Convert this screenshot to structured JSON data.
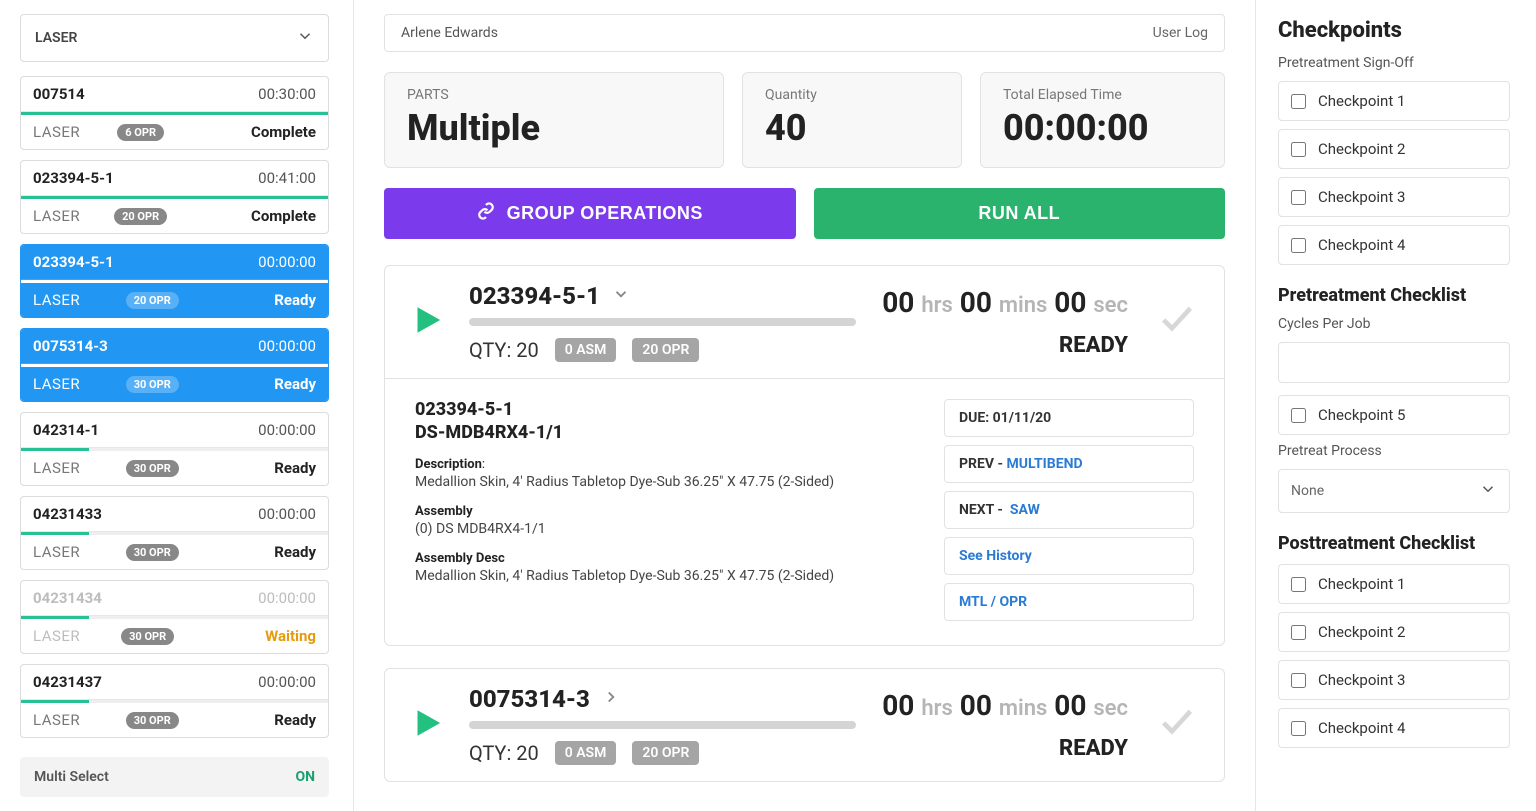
{
  "left": {
    "machine": "LASER",
    "multi_label": "Multi Select",
    "multi_state": "ON",
    "jobs": [
      {
        "id": "007514",
        "time": "00:30:00",
        "machine": "LASER",
        "opr": "6 OPR",
        "status": "Complete",
        "selected": false,
        "dim": false,
        "prog": "full"
      },
      {
        "id": "023394-5-1",
        "time": "00:41:00",
        "machine": "LASER",
        "opr": "20 OPR",
        "status": "Complete",
        "selected": false,
        "dim": false,
        "prog": "full"
      },
      {
        "id": "023394-5-1",
        "time": "00:00:00",
        "machine": "LASER",
        "opr": "20 OPR",
        "status": "Ready",
        "selected": true,
        "dim": false,
        "prog": "full"
      },
      {
        "id": "0075314-3",
        "time": "00:00:00",
        "machine": "LASER",
        "opr": "30 OPR",
        "status": "Ready",
        "selected": true,
        "dim": false,
        "prog": "full"
      },
      {
        "id": "042314-1",
        "time": "00:00:00",
        "machine": "LASER",
        "opr": "30 OPR",
        "status": "Ready",
        "selected": false,
        "dim": false,
        "prog": "part"
      },
      {
        "id": "04231433",
        "time": "00:00:00",
        "machine": "LASER",
        "opr": "30 OPR",
        "status": "Ready",
        "selected": false,
        "dim": false,
        "prog": "part"
      },
      {
        "id": "04231434",
        "time": "00:00:00",
        "machine": "LASER",
        "opr": "30 OPR",
        "status": "Waiting",
        "selected": false,
        "dim": true,
        "prog": "part"
      },
      {
        "id": "04231437",
        "time": "00:00:00",
        "machine": "LASER",
        "opr": "30 OPR",
        "status": "Ready",
        "selected": false,
        "dim": false,
        "prog": "part"
      }
    ]
  },
  "center": {
    "user": "Arlene Edwards",
    "userlog": "User Log",
    "parts_label": "PARTS",
    "parts_value": "Multiple",
    "qty_label": "Quantity",
    "qty_value": "40",
    "elapsed_label": "Total Elapsed Time",
    "elapsed_value": "00:00:00",
    "group_btn": "GROUP OPERATIONS",
    "runall_btn": "RUN ALL",
    "ops": [
      {
        "title": "023394-5-1",
        "qty": "QTY: 20",
        "asm": "0 ASM",
        "opr": "20 OPR",
        "time_h": "00",
        "time_m": "00",
        "time_s": "00",
        "status": "READY",
        "expanded": true,
        "chev": "down",
        "detail": {
          "id": "023394-5-1",
          "code": "DS-MDB4RX4-1/1",
          "desc_label": "Description",
          "desc": "Medallion Skin, 4' Radius Tabletop Dye-Sub 36.25\" X 47.75 (2-Sided)",
          "asm_label": "Assembly",
          "asm": "(0) DS MDB4RX4-1/1",
          "asmdesc_label": "Assembly Desc",
          "asmdesc": "Medallion Skin, 4' Radius Tabletop Dye-Sub 36.25\" X 47.75 (2-Sided)",
          "due_label": "DUE:",
          "due": "01/11/20",
          "prev_label": "PREV -",
          "prev": "MULTIBEND",
          "next_label": "NEXT -",
          "next": "SAW",
          "history": "See History",
          "mtlopr": "MTL / OPR"
        }
      },
      {
        "title": "0075314-3",
        "qty": "QTY: 20",
        "asm": "0 ASM",
        "opr": "20 OPR",
        "time_h": "00",
        "time_m": "00",
        "time_s": "00",
        "status": "READY",
        "expanded": false,
        "chev": "right"
      }
    ],
    "units": {
      "hrs": "hrs",
      "mins": "mins",
      "sec": "sec"
    }
  },
  "right": {
    "title": "Checkpoints",
    "signoff_label": "Pretreatment Sign-Off",
    "signoff": [
      "Checkpoint 1",
      "Checkpoint 2",
      "Checkpoint 3",
      "Checkpoint 4"
    ],
    "pre_title": "Pretreatment Checklist",
    "cycles_label": "Cycles Per Job",
    "pre_items": [
      "Checkpoint 5"
    ],
    "process_label": "Pretreat Process",
    "process_value": "None",
    "post_title": "Posttreatment Checklist",
    "post_items": [
      "Checkpoint 1",
      "Checkpoint 2",
      "Checkpoint 3",
      "Checkpoint 4"
    ]
  }
}
